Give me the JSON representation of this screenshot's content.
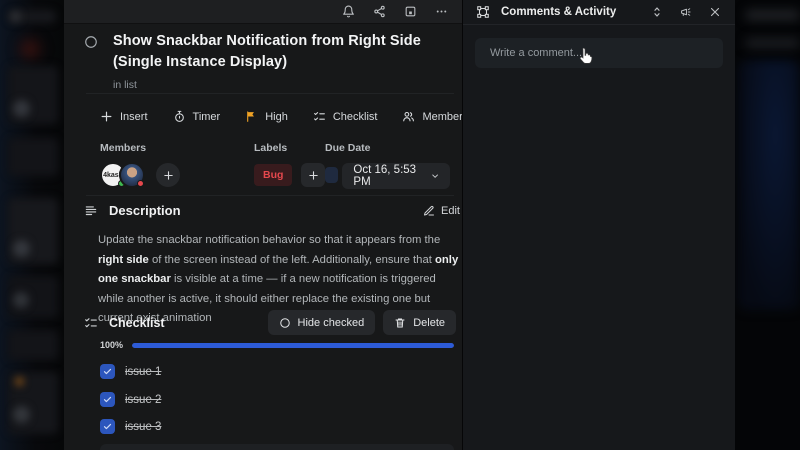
{
  "topbar": {
    "icons": [
      "bell-icon",
      "share-icon",
      "save-icon",
      "more-icon"
    ]
  },
  "card": {
    "title": "Show Snackbar Notification from Right Side (Single Instance Display)",
    "subtitle": "in list",
    "actions": [
      {
        "label": "Insert",
        "icon": "plus-icon"
      },
      {
        "label": "Timer",
        "icon": "stopwatch-icon"
      },
      {
        "label": "High",
        "icon": "flag-icon"
      },
      {
        "label": "Checklist",
        "icon": "checklist-icon"
      },
      {
        "label": "Members",
        "icon": "members-icon"
      }
    ],
    "fields": {
      "members_label": "Members",
      "labels_label": "Labels",
      "due_label": "Due Date",
      "label_chip": "Bug",
      "due_value": "Oct 16, 5:53 PM",
      "avatars": [
        {
          "status": "online"
        },
        {
          "status": "busy"
        }
      ]
    },
    "description": {
      "heading": "Description",
      "edit_label": "Edit",
      "parts": {
        "p1": "Update the snackbar notification behavior so that it appears from the ",
        "b1": "right side",
        "p2": " of the screen instead of the left. Additionally, ensure that ",
        "b2": "only one snackbar",
        "p3": " is visible at a time — if a new notification is triggered while another is active, it should either replace the existing one but current exist animation"
      }
    },
    "checklist": {
      "heading": "Checklist",
      "hide_checked_label": "Hide checked",
      "delete_label": "Delete",
      "progress_percent": 100,
      "progress_label": "100%",
      "items": [
        {
          "label": "issue 1",
          "checked": true
        },
        {
          "label": "issue 2",
          "checked": true
        },
        {
          "label": "issue 3",
          "checked": true
        }
      ]
    }
  },
  "comments": {
    "heading": "Comments & Activity",
    "input_placeholder": "Write a comment..."
  },
  "colors": {
    "accent_blue": "#2d5bd7",
    "checkbox_blue": "#2c56bd",
    "flag_orange": "#f0a225",
    "bug_red": "#e5484d",
    "online_green": "#3fb950",
    "busy_red": "#e5484d"
  }
}
